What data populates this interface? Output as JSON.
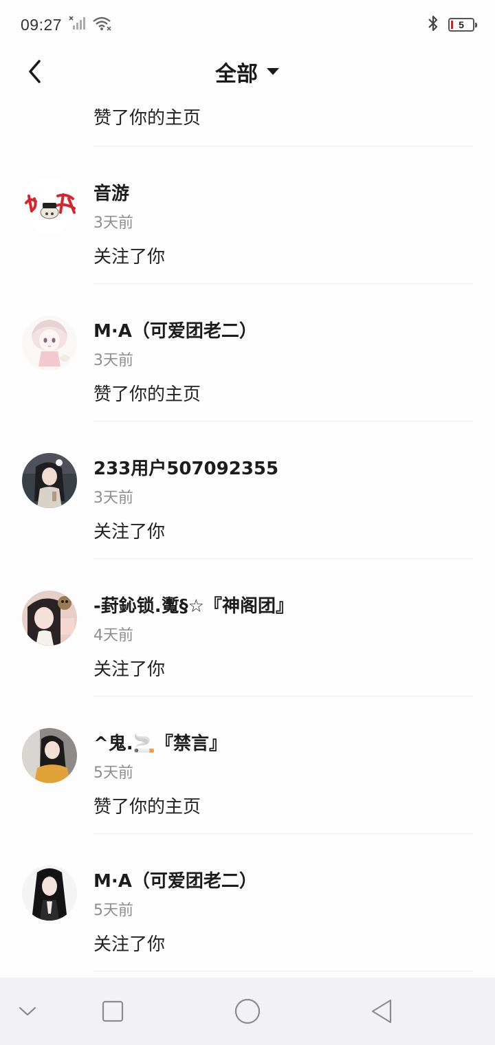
{
  "status_bar": {
    "time": "09:27",
    "battery": "5",
    "icons": [
      "signal-off-icon",
      "wifi-icon",
      "bluetooth-icon",
      "battery-icon"
    ]
  },
  "header": {
    "title": "全部",
    "back_icon": "back-chevron-icon",
    "dropdown_icon": "caret-down-icon"
  },
  "partial_item": {
    "action": "赞了你的主页"
  },
  "notifications": [
    {
      "name": "音游",
      "time": "3天前",
      "action": "关注了你",
      "avatar": "red-calligraphy-avatar"
    },
    {
      "name": "M·A（可爱团老二）",
      "time": "3天前",
      "action": "赞了你的主页",
      "avatar": "anime-girl-avatar"
    },
    {
      "name": "233用户507092355",
      "time": "3天前",
      "action": "关注了你",
      "avatar": "dark-hair-girl-avatar"
    },
    {
      "name": "-葑鈊锁.魙§☆『神阁团』",
      "time": "4天前",
      "action": "关注了你",
      "avatar": "selfie-girl-avatar"
    },
    {
      "name": "^鬼.🚬『禁言』",
      "time": "5天前",
      "action": "赞了你的主页",
      "avatar": "yellow-shirt-girl-avatar"
    },
    {
      "name": "M·A（可爱团老二）",
      "time": "5天前",
      "action": "关注了你",
      "avatar": "black-hair-girl-avatar"
    }
  ],
  "nav_bar": {
    "icons": [
      "collapse-down-icon",
      "recents-square-icon",
      "home-circle-icon",
      "back-triangle-icon"
    ]
  },
  "colors": {
    "background": "#fdfdfe",
    "secondary_text": "#8e8e8e",
    "nav_bar": "#f2f2f4",
    "battery_low": "#d21f1f"
  }
}
